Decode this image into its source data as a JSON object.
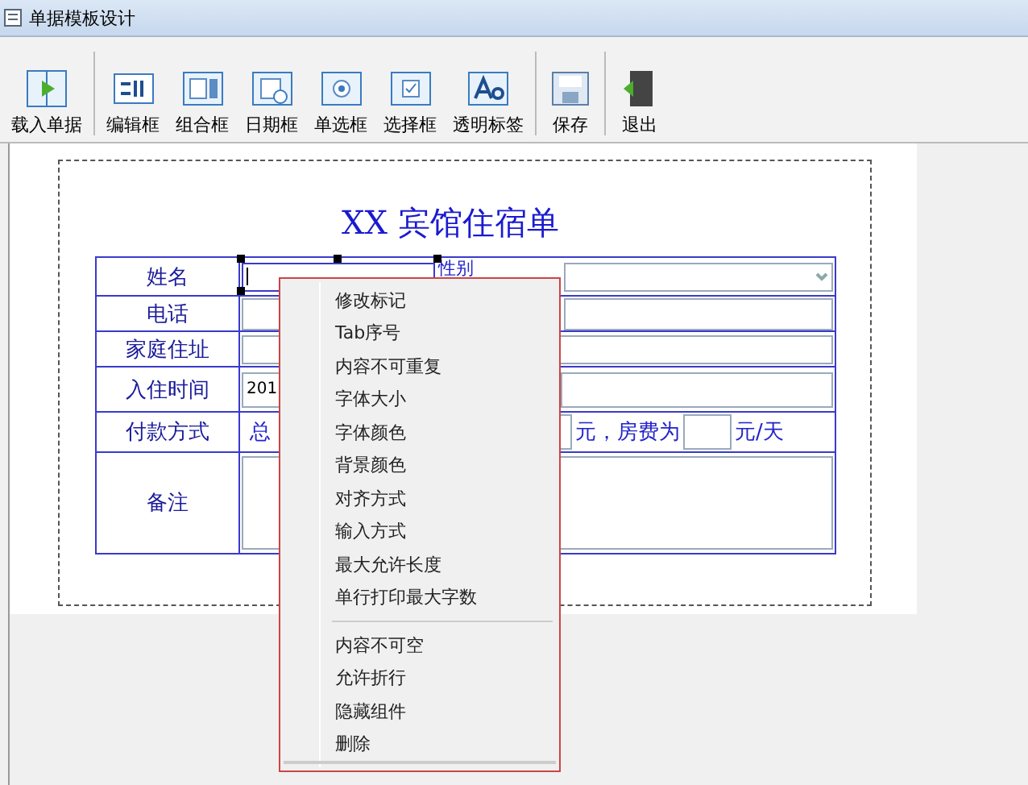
{
  "window": {
    "title": "单据模板设计"
  },
  "toolbar": [
    {
      "label": "载入单据",
      "kind": "load"
    },
    {
      "label": "编辑框",
      "kind": "edit"
    },
    {
      "label": "组合框",
      "kind": "combo"
    },
    {
      "label": "日期框",
      "kind": "date"
    },
    {
      "label": "单选框",
      "kind": "radio"
    },
    {
      "label": "选择框",
      "kind": "check"
    },
    {
      "label": "透明标签",
      "kind": "label"
    },
    {
      "label": "保存",
      "kind": "save"
    },
    {
      "label": "退出",
      "kind": "exit"
    }
  ],
  "form": {
    "title": "XX 宾馆住宿单",
    "rows": [
      {
        "label": "姓名"
      },
      {
        "label": "电话"
      },
      {
        "label": "家庭住址"
      },
      {
        "label": "入住时间"
      },
      {
        "label": "付款方式"
      },
      {
        "label": "备注"
      }
    ],
    "gender_label": "性别",
    "date_value": "201",
    "payment_prefix": "总",
    "payment_middle": "元，房费为",
    "payment_suffix": "元/天"
  },
  "context_menu": {
    "groups": [
      [
        "修改标记",
        "Tab序号",
        "内容不可重复",
        "字体大小",
        "字体颜色",
        "背景颜色",
        "对齐方式",
        "输入方式",
        "最大允许长度",
        "单行打印最大字数"
      ],
      [
        "内容不可空",
        "允许折行",
        "隐藏组件",
        "删除"
      ]
    ]
  }
}
